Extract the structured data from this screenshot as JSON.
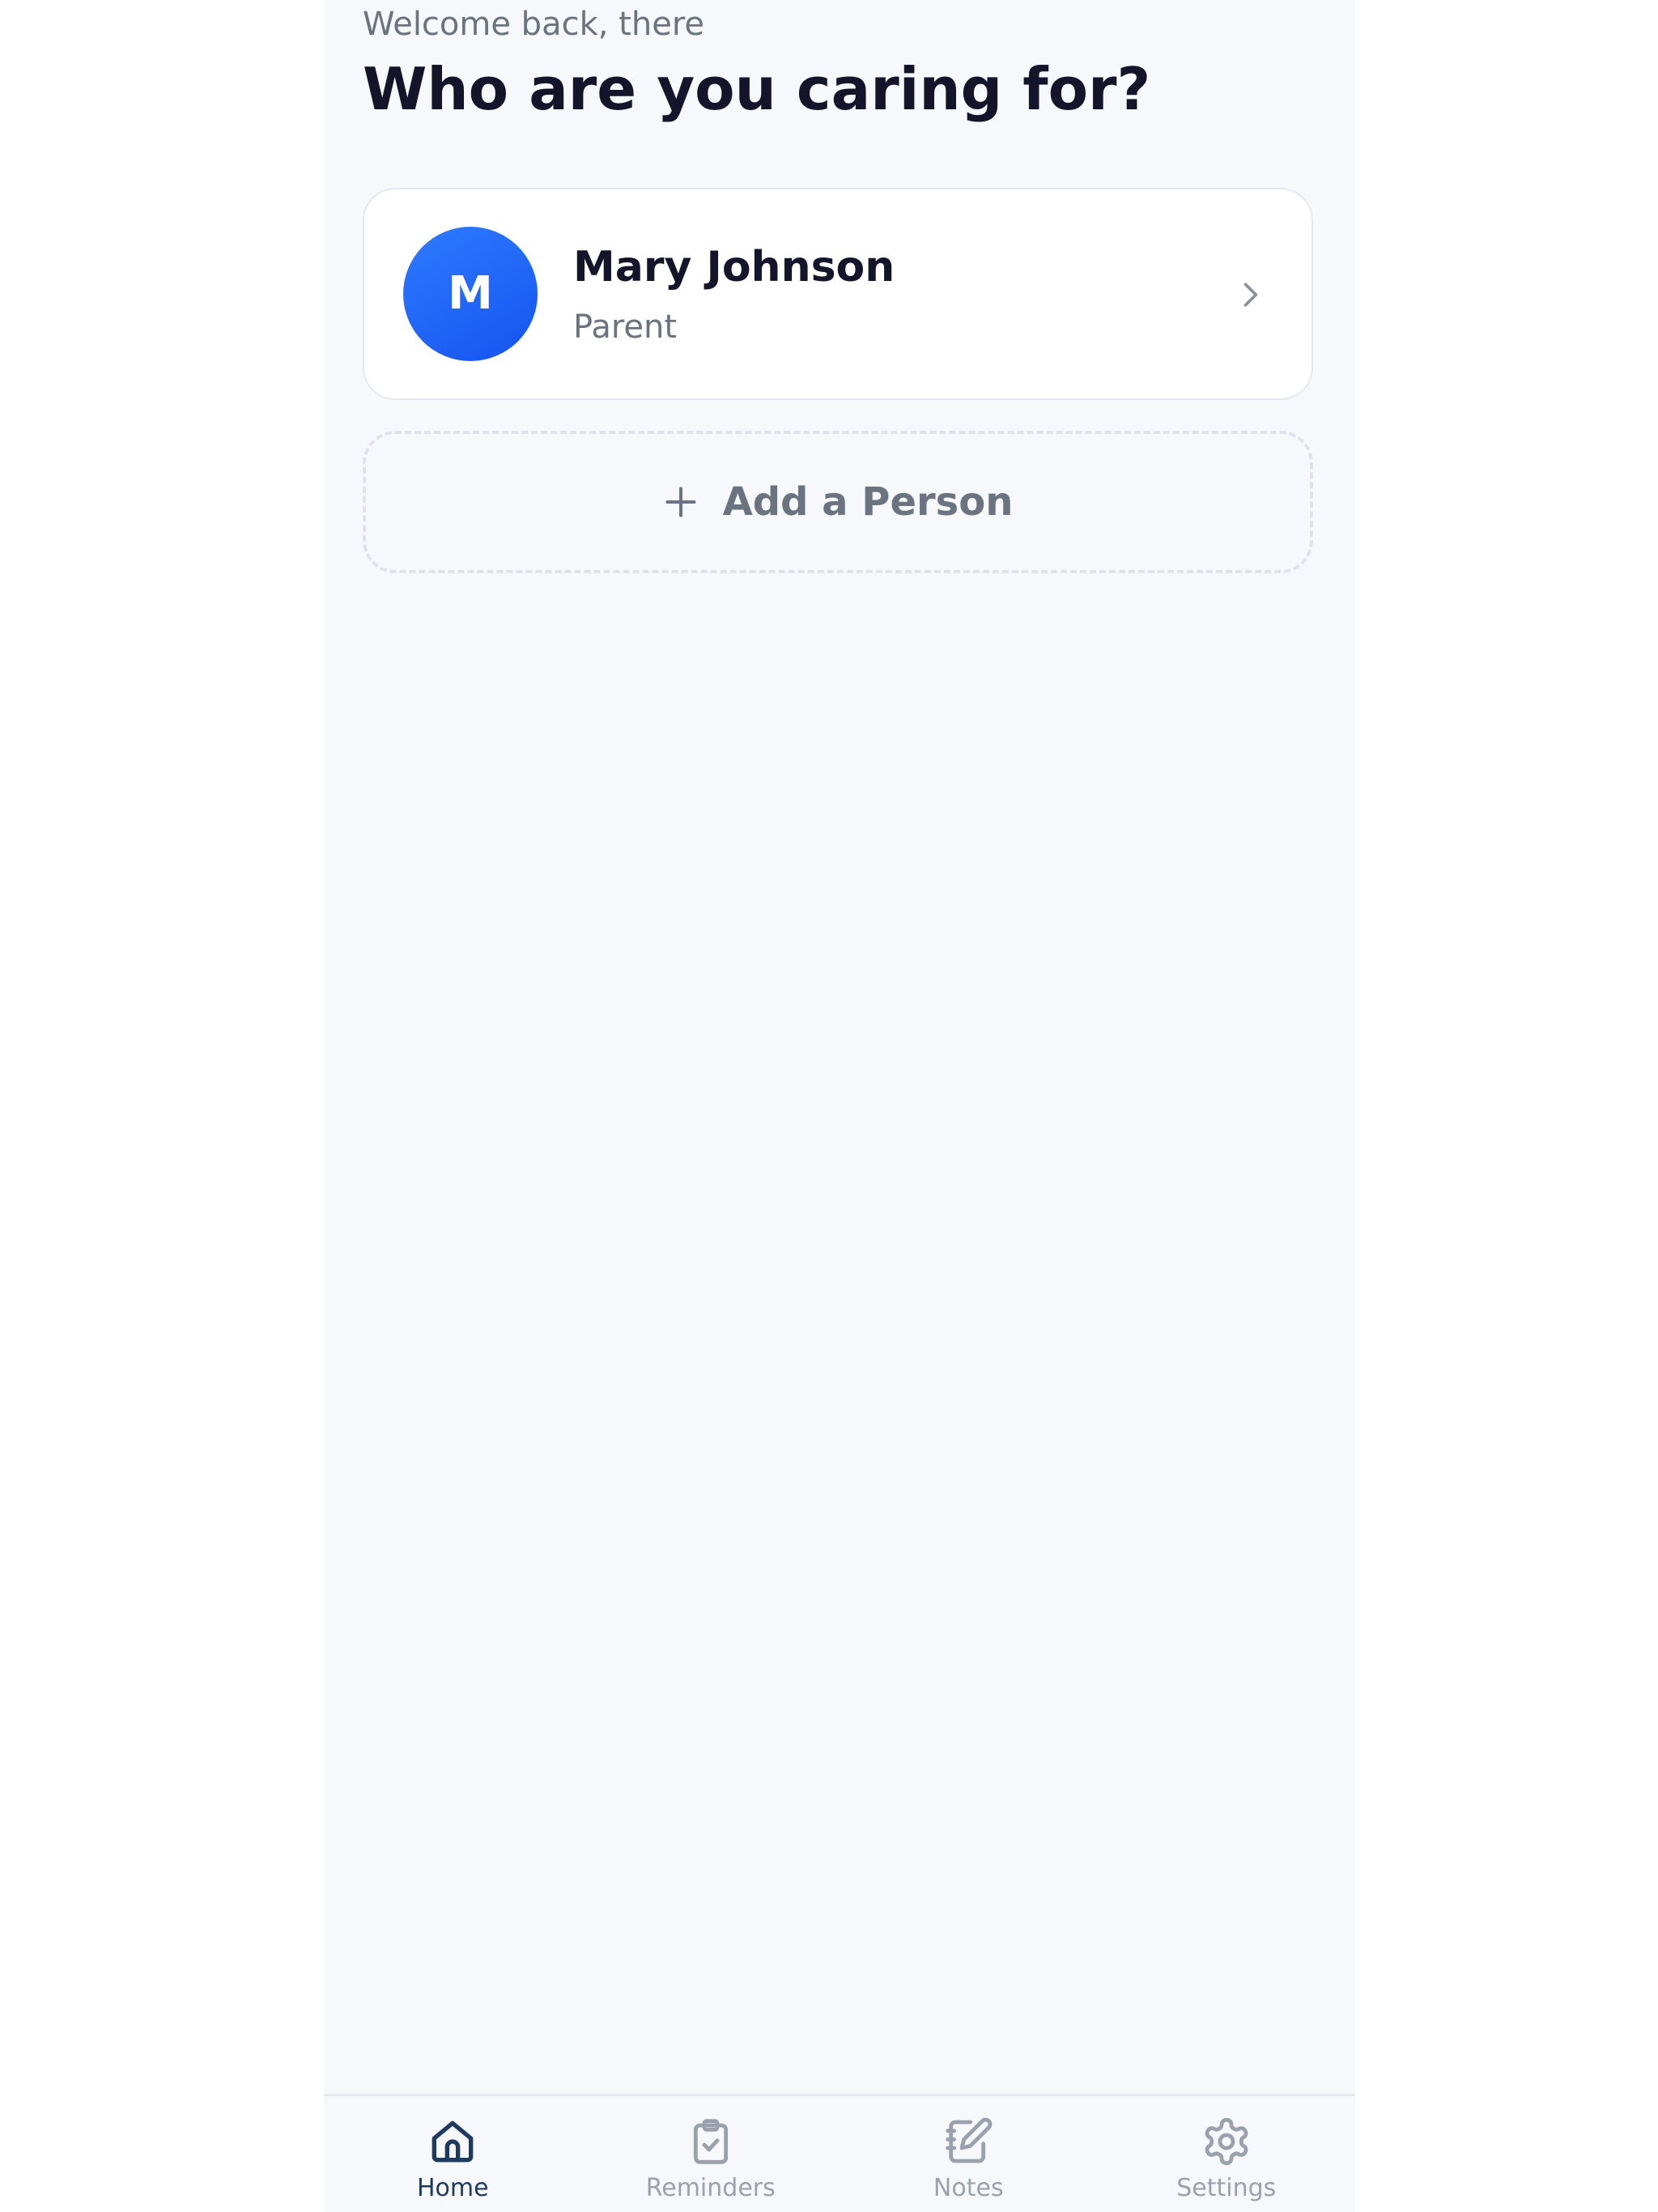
{
  "header": {
    "welcome_text": "Welcome back, there",
    "title": "Who are you caring for?"
  },
  "people": [
    {
      "initial": "M",
      "name": "Mary Johnson",
      "relation": "Parent",
      "avatar_color": "#1f66ff"
    }
  ],
  "add_person": {
    "label": "Add a Person",
    "icon": "plus-icon"
  },
  "bottom_nav": {
    "active": "Home",
    "items": [
      {
        "label": "Home",
        "icon": "home-icon"
      },
      {
        "label": "Reminders",
        "icon": "clipboard-check-icon"
      },
      {
        "label": "Notes",
        "icon": "notebook-pen-icon"
      },
      {
        "label": "Settings",
        "icon": "gear-icon"
      }
    ]
  },
  "colors": {
    "background": "#f6f8fc",
    "accent": "#1f66ff",
    "title_text": "#14142b",
    "muted_text": "#6b7280",
    "nav_active": "#1e3a5f",
    "nav_inactive": "#9aa1ad"
  }
}
